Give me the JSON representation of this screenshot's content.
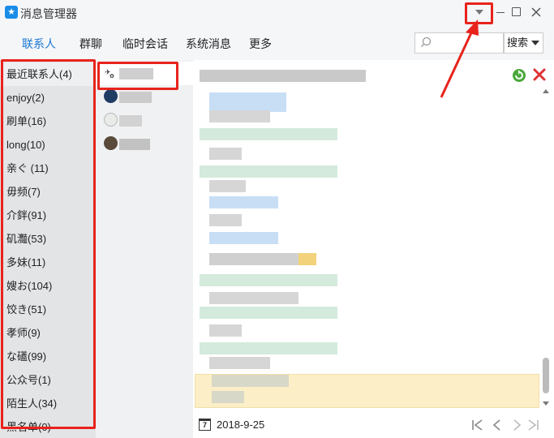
{
  "window": {
    "title": "消息管理器"
  },
  "nav": {
    "tabs": [
      "联系人",
      "群聊",
      "临时会话",
      "系统消息",
      "更多"
    ],
    "active_tab": 0,
    "search_placeholder": "",
    "search_button": "搜索"
  },
  "categories": [
    "最近联系人(4)",
    "enjoy(2)",
    "刷单(16)",
    "long(10)",
    "亲ぐ (11)",
    "毋频(7)",
    "介鉡(91)",
    "矶灩(53)",
    "多妹(11)",
    "嫂お(104)",
    "饺き(51)",
    "孝师(9)",
    "な礚(99)",
    "公众号(1)",
    "陌生人(34)",
    "黑名单(0)"
  ],
  "footer": {
    "date": "2018-9-25",
    "calendar_glyph": "7"
  },
  "colors": {
    "accent": "#1977d2",
    "annotation": "#e8231c",
    "highlight": "#fcefc7"
  }
}
